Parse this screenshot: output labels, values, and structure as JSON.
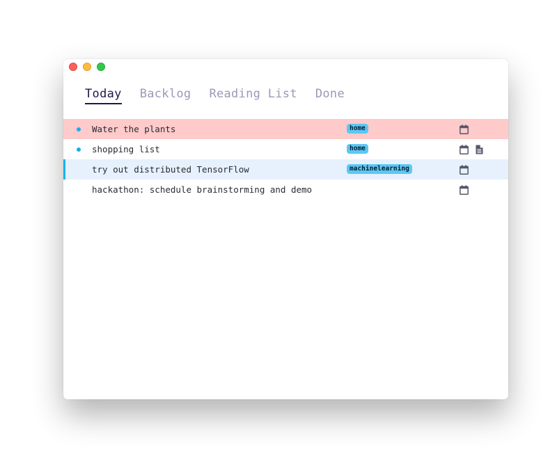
{
  "window": {
    "traffic_lights": [
      "close",
      "minimize",
      "zoom"
    ]
  },
  "tabs": [
    {
      "label": "Today",
      "active": true
    },
    {
      "label": "Backlog",
      "active": false
    },
    {
      "label": "Reading List",
      "active": false
    },
    {
      "label": "Done",
      "active": false
    }
  ],
  "tasks": [
    {
      "title": "Water the plants",
      "tag": "home",
      "bullet": true,
      "icons": [
        "calendar-icon"
      ],
      "state": "urgent"
    },
    {
      "title": "shopping list",
      "tag": "home",
      "bullet": true,
      "icons": [
        "calendar-icon",
        "note-icon"
      ],
      "state": "normal"
    },
    {
      "title": "try out distributed TensorFlow",
      "tag": "machinelearning",
      "bullet": false,
      "icons": [
        "calendar-icon"
      ],
      "state": "selected"
    },
    {
      "title": "hackathon: schedule brainstorming and demo",
      "tag": "",
      "bullet": false,
      "icons": [
        "calendar-icon"
      ],
      "state": "normal"
    }
  ],
  "colors": {
    "urgent_row": "#fecaca",
    "selected_row": "#e6f1fd",
    "accent_blue": "#14aef0",
    "tag_bg": "#5bc8f5",
    "active_tab": "#1c1a4a",
    "inactive_tab": "#9b98b8",
    "icon": "#55576a"
  }
}
